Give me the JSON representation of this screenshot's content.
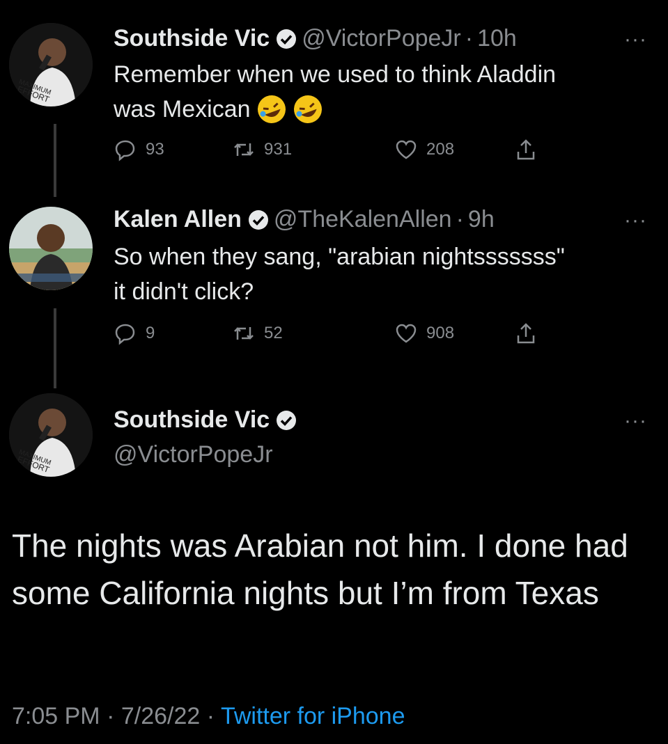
{
  "tweets": [
    {
      "name": "Southside Vic",
      "handle": "@VictorPopeJr",
      "sep": "·",
      "time": "10h",
      "line1": "Remember when we used to think Aladdin",
      "line2": "was Mexican",
      "emoji": "rolling-on-floor-laughing",
      "replies": "93",
      "retweets": "931",
      "likes": "208",
      "avatar_text": "MAXIMUM EFFORT"
    },
    {
      "name": "Kalen Allen",
      "handle": "@TheKalenAllen",
      "sep": "·",
      "time": "9h",
      "line1": "So when they sang, \"arabian nightsssssss\"",
      "line2": "it didn't click?",
      "replies": "9",
      "retweets": "52",
      "likes": "908"
    }
  ],
  "main": {
    "name": "Southside Vic",
    "handle": "@VictorPopeJr",
    "avatar_text": "MAXIMUM EFFORT",
    "text": "The nights was Arabian not him. I done had some California nights but I’m from Texas",
    "time": "7:05 PM",
    "date": "7/26/22",
    "dot": "·",
    "source": "Twitter for iPhone"
  },
  "icons": {
    "verified": "verified-badge-icon",
    "reply": "reply-icon",
    "retweet": "retweet-icon",
    "like": "heart-icon",
    "share": "share-icon",
    "more": "more-icon"
  },
  "more_label": "···",
  "colors": {
    "background": "#000000",
    "text": "#e7e9ea",
    "muted": "#8a8d91",
    "link": "#1d9bf0"
  }
}
